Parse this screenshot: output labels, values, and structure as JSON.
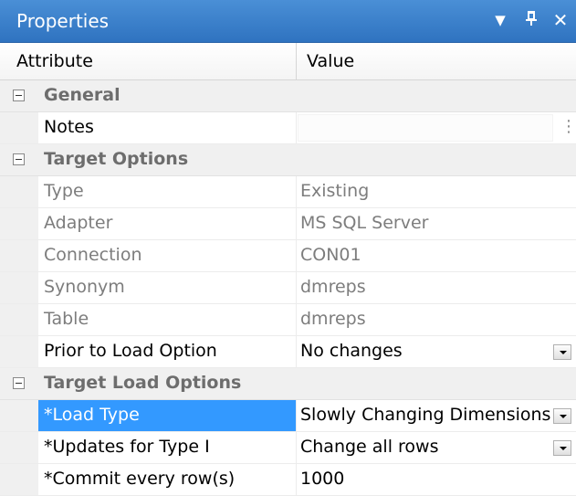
{
  "window": {
    "title": "Properties",
    "buttons": {
      "dropdown_icon": "▼",
      "pin_icon": "ᴾ",
      "close_icon": "✕"
    }
  },
  "header": {
    "attribute": "Attribute",
    "value": "Value"
  },
  "sections": {
    "general": {
      "label": "General",
      "rows": {
        "notes": {
          "label": "Notes",
          "value": ""
        }
      }
    },
    "target_options": {
      "label": "Target Options",
      "rows": {
        "type": {
          "label": "Type",
          "value": "Existing"
        },
        "adapter": {
          "label": "Adapter",
          "value": "MS SQL Server"
        },
        "connection": {
          "label": "Connection",
          "value": "CON01"
        },
        "synonym": {
          "label": "Synonym",
          "value": "dmreps"
        },
        "table": {
          "label": "Table",
          "value": "dmreps"
        },
        "prior_load": {
          "label": "Prior to Load Option",
          "value": "No changes"
        }
      }
    },
    "target_load_options": {
      "label": "Target Load Options",
      "rows": {
        "load_type": {
          "label": "*Load Type",
          "value": "Slowly Changing Dimensions"
        },
        "updates_type1": {
          "label": "*Updates for Type I",
          "value": "Change all rows"
        },
        "commit_every": {
          "label": "*Commit every row(s)",
          "value": "1000"
        }
      }
    }
  },
  "colors": {
    "title_bar": "#3a82cf",
    "selection": "#3399ff",
    "category_text": "#6d6d6d"
  }
}
